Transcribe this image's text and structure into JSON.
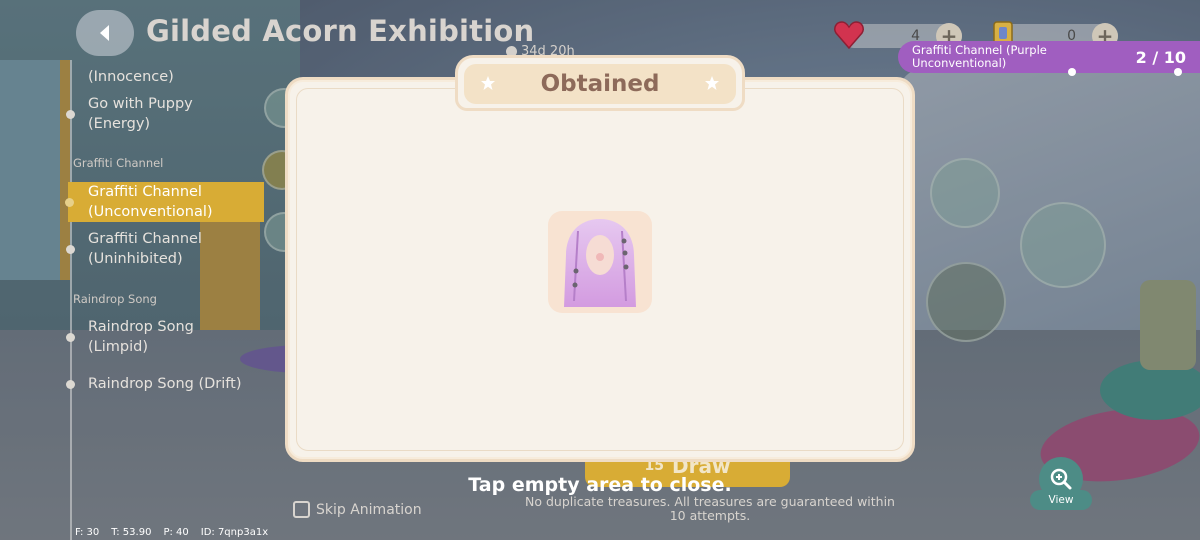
{
  "header": {
    "title": "Gilded Acorn Exhibition",
    "timer": "34d 20h"
  },
  "currency": [
    {
      "icon": "heart-gem-icon",
      "value": "4"
    },
    {
      "icon": "ticket-icon",
      "value": "0"
    }
  ],
  "banner": {
    "name": "Graffiti Channel (Purple Unconventional)",
    "count": "2 / 10"
  },
  "sidebar": {
    "items": [
      {
        "label": "(Innocence)"
      },
      {
        "label": "Go with Puppy (Energy)"
      },
      {
        "group": "Graffiti Channel"
      },
      {
        "label": "Graffiti Channel (Unconventional)",
        "active": true
      },
      {
        "label": "Graffiti Channel (Uninhibited)"
      },
      {
        "group": "Raindrop Song"
      },
      {
        "label": "Raindrop Song (Limpid)"
      },
      {
        "label": "Raindrop Song (Drift)"
      }
    ]
  },
  "modal": {
    "title": "Obtained",
    "item_icon": "pink-hair-icon"
  },
  "bottom": {
    "skip_label": "Skip Animation",
    "draw_cost": "15",
    "draw_label": "Draw",
    "tap_hint": "Tap empty area to close.",
    "note": "No duplicate treasures. All treasures are guaranteed within 10 attempts.",
    "view_label": "View"
  },
  "stats": {
    "f": "F: 30",
    "t": "T: 53.90",
    "p": "P: 40",
    "id": "ID: 7qnp3a1x"
  },
  "colors": {
    "accent_gold": "#d8ac35",
    "banner_purple": "#a05ec0",
    "modal_bg": "#f7f2ea",
    "title_text": "#8d6a5a"
  }
}
